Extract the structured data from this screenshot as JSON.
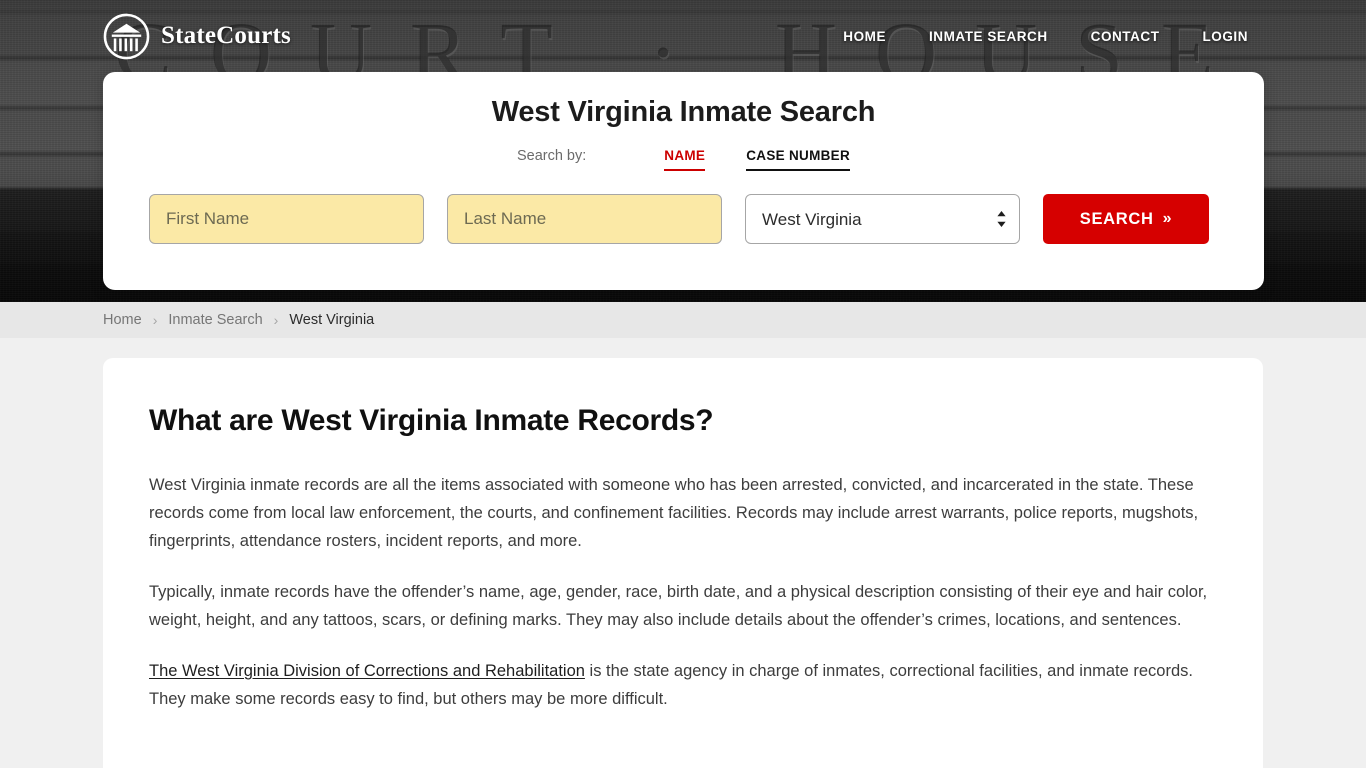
{
  "header": {
    "brand_name": "StateCourts",
    "logo_icon": "courthouse-circle-icon",
    "background_engraving": "COURT · HOUSE",
    "nav": [
      {
        "label": "HOME",
        "name": "home"
      },
      {
        "label": "INMATE SEARCH",
        "name": "inmate-search"
      },
      {
        "label": "CONTACT",
        "name": "contact"
      },
      {
        "label": "LOGIN",
        "name": "login"
      }
    ]
  },
  "search_card": {
    "title": "West Virginia Inmate Search",
    "search_by_label": "Search by:",
    "tabs": [
      {
        "label": "NAME",
        "active": true,
        "color": "#cc0000"
      },
      {
        "label": "CASE NUMBER",
        "active": false,
        "color": "#111111"
      }
    ],
    "first_name": {
      "value": "",
      "placeholder": "First Name"
    },
    "last_name": {
      "value": "",
      "placeholder": "Last Name"
    },
    "state_select": {
      "selected": "West Virginia",
      "caret_icon": "chevron-up-down-icon"
    },
    "submit": {
      "label": "SEARCH",
      "icon": "double-chevron-right-icon"
    }
  },
  "breadcrumb": {
    "items": [
      {
        "label": "Home"
      },
      {
        "label": "Inmate Search"
      },
      {
        "label": "West Virginia"
      }
    ],
    "separator": "›"
  },
  "main": {
    "heading": "What are West Virginia Inmate Records?",
    "paragraph_1": "West Virginia inmate records are all the items associated with someone who has been arrested, convicted, and incarcerated in the state. These records come from local law enforcement, the courts, and confinement facilities. Records may include arrest warrants, police reports, mugshots, fingerprints, attendance rosters, incident reports, and more.",
    "paragraph_2": "Typically, inmate records have the offender’s name, age, gender, race, birth date, and a physical description consisting of their eye and hair color, weight, height, and any tattoos, scars, or defining marks. They may also include details about the offender’s crimes, locations, and sentences.",
    "paragraph_3_link": "The West Virginia Division of Corrections and Rehabilitation",
    "paragraph_3_rest": " is the state agency in charge of inmates, correctional facilities, and inmate records. They make some records easy to find, but others may be more difficult."
  },
  "colors": {
    "accent_red": "#cc0000",
    "button_red": "#d60000",
    "autofill_yellow": "#fbe9a6",
    "page_bg": "#f0f0f0",
    "breadcrumb_bg": "#e7e7e7"
  }
}
